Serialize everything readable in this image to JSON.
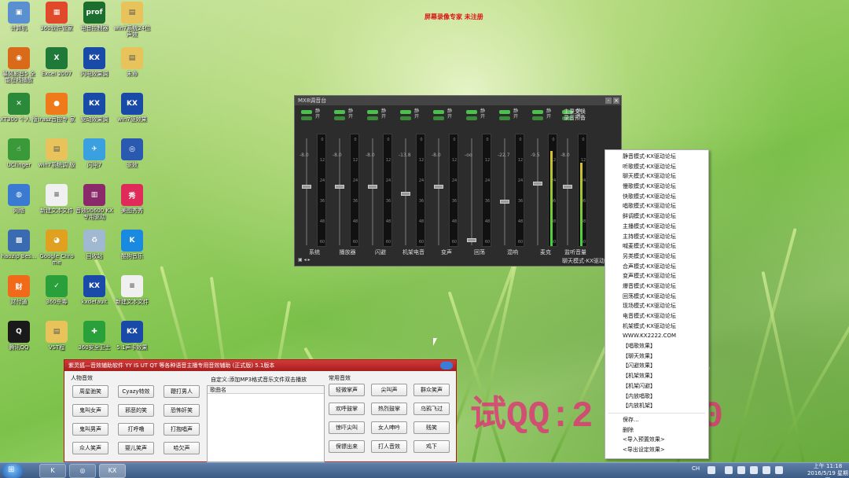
{
  "top_banner": "屏幕录像专家  未注册",
  "watermark": "试QQ:2    47330",
  "desktop_icons": [
    {
      "label": "计算机",
      "icon": "computer-icon",
      "color": "#5a8fd0",
      "glyph": "▣"
    },
    {
      "label": "360软件管家",
      "icon": "360-manager-icon",
      "color": "#e04a2a",
      "glyph": "▦"
    },
    {
      "label": "电音控制器",
      "icon": "professor-icon",
      "color": "#1b6e2e",
      "glyph": "prof"
    },
    {
      "label": "win7系统24位声效",
      "icon": "folder-icon",
      "color": "#e8c25a",
      "glyph": "▤"
    },
    {
      "label": "暴风影音5 全能在线播放",
      "icon": "baofeng-icon",
      "color": "#d86a1a",
      "glyph": "◉"
    },
    {
      "label": "Excel 2007",
      "icon": "excel-icon",
      "color": "#1f7a3a",
      "glyph": "X"
    },
    {
      "label": "闪电效果调",
      "icon": "kx-icon",
      "color": "#1a4aa8",
      "glyph": "KX"
    },
    {
      "label": "未命",
      "icon": "folder-icon",
      "color": "#e8c25a",
      "glyph": "▤"
    },
    {
      "label": "XT300 个人 版",
      "icon": "xt300-icon",
      "color": "#2a8a3a",
      "glyph": "✕"
    },
    {
      "label": "irasz音控专 家",
      "icon": "orange-icon",
      "color": "#f07a1a",
      "glyph": "●"
    },
    {
      "label": "驱动效果调",
      "icon": "kx-icon",
      "color": "#1a4aa8",
      "glyph": "KX"
    },
    {
      "label": "win7驱效果",
      "icon": "kx-icon",
      "color": "#1a4aa8",
      "glyph": "KX"
    },
    {
      "label": "UCfinger",
      "icon": "ucfinger-icon",
      "color": "#3a9a3a",
      "glyph": "☝"
    },
    {
      "label": "win7系统调 版",
      "icon": "folder-icon",
      "color": "#e8c25a",
      "glyph": "▤"
    },
    {
      "label": "闪电7",
      "icon": "bird-icon",
      "color": "#3aa0e0",
      "glyph": "✈"
    },
    {
      "label": "驱效",
      "icon": "speaker-icon",
      "color": "#2a5ab0",
      "glyph": "◎"
    },
    {
      "label": "网络",
      "icon": "network-icon",
      "color": "#3a7ad0",
      "glyph": "◍"
    },
    {
      "label": "新建文本文件",
      "icon": "text-file-icon",
      "color": "#f0f0f0",
      "glyph": "≡"
    },
    {
      "label": "音效00600 KX 专用驱动",
      "icon": "winrar-icon",
      "color": "#8a2a6a",
      "glyph": "▥"
    },
    {
      "label": "美图秀秀",
      "icon": "meitu-icon",
      "color": "#e02a5a",
      "glyph": "秀"
    },
    {
      "label": "haozip Bes...",
      "icon": "haozip-icon",
      "color": "#3a6ab0",
      "glyph": "▩"
    },
    {
      "label": "Google Chrome",
      "icon": "chrome-icon",
      "color": "#e0a020",
      "glyph": "◕"
    },
    {
      "label": "回收站",
      "icon": "recycle-bin-icon",
      "color": "#a0b8d0",
      "glyph": "♻"
    },
    {
      "label": "酷狗音乐",
      "icon": "kugou-icon",
      "color": "#1a8ae0",
      "glyph": "K"
    },
    {
      "label": "财付通",
      "icon": "tenpay-icon",
      "color": "#f06a1a",
      "glyph": "财"
    },
    {
      "label": "360杀毒",
      "icon": "360-antivirus-icon",
      "color": "#2aa03a",
      "glyph": "✓"
    },
    {
      "label": "kxdefault",
      "icon": "kx-icon",
      "color": "#1a4aa8",
      "glyph": "KX"
    },
    {
      "label": "新建文本文件",
      "icon": "text-file-icon",
      "color": "#f0f0f0",
      "glyph": "≡"
    },
    {
      "label": "腾讯QQ",
      "icon": "qq-icon",
      "color": "#1a1a1a",
      "glyph": "Q"
    },
    {
      "label": "VST程",
      "icon": "folder-icon",
      "color": "#e8c25a",
      "glyph": "▤"
    },
    {
      "label": "360安全卫士",
      "icon": "360-safe-icon",
      "color": "#2aa03a",
      "glyph": "✚"
    },
    {
      "label": "5.1声卡效果",
      "icon": "kx-icon",
      "color": "#1a4aa8",
      "glyph": "KX"
    }
  ],
  "mixer": {
    "title": "MX8调音台",
    "side_labels": [
      "主录交换",
      "录音预备"
    ],
    "status": "聊天模式-KX驱动",
    "bottom_controls": "▣ ◂ ▸",
    "channels": [
      {
        "name": "系统",
        "value": "-8.0",
        "knob": 0.45,
        "meter": 0
      },
      {
        "name": "播放器",
        "value": "-8.0",
        "knob": 0.45,
        "meter": 0
      },
      {
        "name": "闪避",
        "value": "-8.0",
        "knob": 0.45,
        "meter": 0
      },
      {
        "name": "机架电音",
        "value": "-13.8",
        "knob": 0.52,
        "meter": 0
      },
      {
        "name": "变声",
        "value": "-8.0",
        "knob": 0.45,
        "meter": 0
      },
      {
        "name": "回荡",
        "value": "-oo",
        "knob": 0.98,
        "meter": 0
      },
      {
        "name": "混响",
        "value": "-22.7",
        "knob": 0.6,
        "meter": 0
      },
      {
        "name": "麦克",
        "value": "-9.5",
        "knob": 0.42,
        "meter": 0.85
      },
      {
        "name": "监听音量",
        "value": "-8.0",
        "knob": 0.45,
        "meter": 0.75
      }
    ],
    "meter_scale": [
      "0",
      "12",
      "24",
      "36",
      "48",
      "60"
    ]
  },
  "context_menu": {
    "items": [
      "静音模式-KX驱动论坛",
      "听歌模式-KX驱动论坛",
      "聊天模式-KX驱动论坛",
      "慢歌模式-KX驱动论坛",
      "快歌模式-KX驱动论坛",
      "唱歌模式-KX驱动论坛",
      "鲜调模式-KX驱动论坛",
      "主播模式-KX驱动论坛",
      "主持模式-KX驱动论坛",
      "喊麦模式-KX驱动论坛",
      "另类模式-KX驱动论坛",
      "合声模式-KX驱动论坛",
      "变声模式-KX驱动论坛",
      "爆音模式-KX驱动论坛",
      "回荡模式-KX驱动论坛",
      "现场模式-KX驱动论坛",
      "电音模式-KX驱动论坛",
      "机架模式-KX驱动论坛",
      "WWW.KX2222.COM",
      "【唱歌效果】",
      "【聊天效果】",
      "【闪避效果】",
      "【机架效果】",
      "【机架闪避】",
      "【内放唱歌】",
      "【内放机架】"
    ],
    "footer": [
      "保存...",
      "删除",
      "<导入预置效果>",
      "<导出设定效果>"
    ]
  },
  "helper": {
    "title": "紫灵狐—音效辅助软件   YY  IS  UT  QT  等各种语音主播专用音效辅助   (正式版)  5.1版本",
    "person_section": "人物音效",
    "custom_section": "自定义:添加MP3格式音乐文件双击播放",
    "common_section": "常用音效",
    "list_header": "歌曲名",
    "person_buttons": [
      "周星驰笑",
      "Cyazy特效",
      "鞭打男人",
      "鬼叫女声",
      "邪恶的笑",
      "恐怖奸笑",
      "鬼叫男声",
      "打呼噜",
      "打抱唱声",
      "众人笑声",
      "婴儿笑声",
      "哈欠声"
    ],
    "common_buttons": [
      "轻微掌声",
      "尖叫声",
      "群众笑声",
      "欢呼鼓掌",
      "热烈鼓掌",
      "乌鸦飞过",
      "惊吓尖叫",
      "女人呻吟",
      "贱笑",
      "保镖出来",
      "打人音效",
      "鸡下"
    ]
  },
  "taskbar": {
    "start": "⊞",
    "apps": [
      "K",
      "◎",
      "KX"
    ],
    "tray_lang": "CH",
    "time": "上午 11:18",
    "date": "2016/5/19 星期四"
  }
}
